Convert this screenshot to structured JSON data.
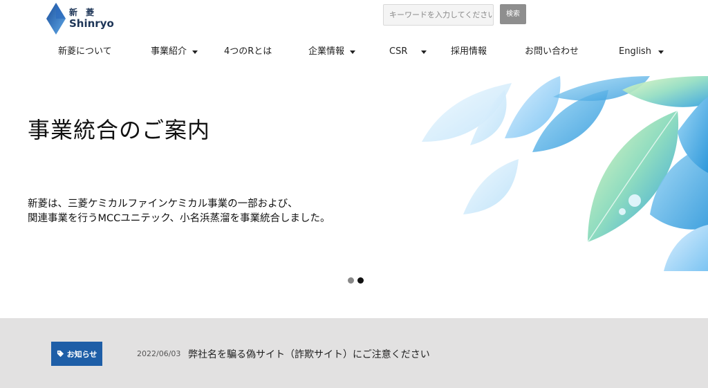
{
  "header": {
    "logo_jp": "新 菱",
    "logo_en": "Shinryo",
    "search_placeholder": "キーワードを入力してください",
    "search_button": "検索"
  },
  "nav": {
    "items": [
      {
        "label": "新菱について",
        "dropdown": false
      },
      {
        "label": "事業紹介",
        "dropdown": true
      },
      {
        "label": "4つのRとは",
        "dropdown": false
      },
      {
        "label": "企業情報",
        "dropdown": true
      },
      {
        "label": "CSR",
        "dropdown": true
      },
      {
        "label": "採用情報",
        "dropdown": false
      },
      {
        "label": "お問い合わせ",
        "dropdown": false
      },
      {
        "label": "English",
        "dropdown": true
      }
    ]
  },
  "hero": {
    "title": "事業統合のご案内",
    "desc_line1": "新菱は、三菱ケミカルファインケミカル事業の一部および、",
    "desc_line2": "関連事業を行うMCCユニテック、小名浜蒸溜を事業統合しました。",
    "slides_total": 2,
    "active_slide": 2
  },
  "news": {
    "badge": "お知らせ",
    "items": [
      {
        "date": "2022/06/03",
        "title": "弊社名を騙る偽サイト（詐欺サイト）にご注意ください"
      }
    ]
  },
  "colors": {
    "accent": "#1e5ea7",
    "news_bg": "#e2e1e1",
    "search_button_bg": "#8e8e8e"
  }
}
